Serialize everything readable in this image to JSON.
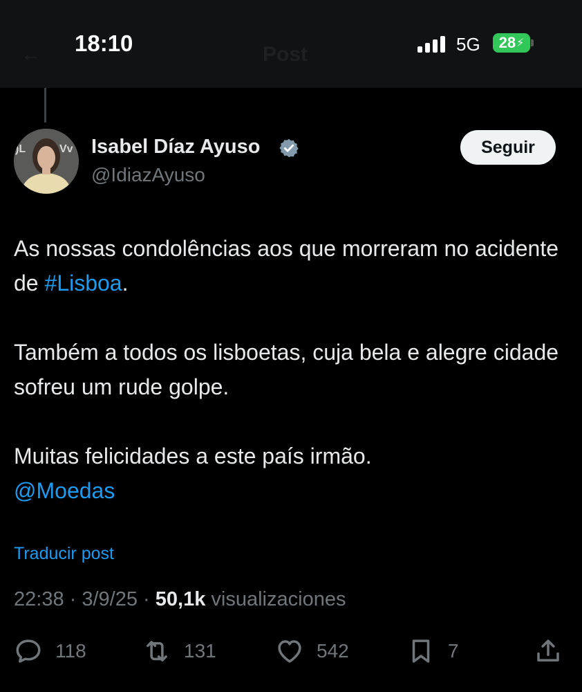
{
  "status_bar": {
    "time": "18:10",
    "network": "5G",
    "battery": "28",
    "background_title": "Post"
  },
  "author": {
    "name": "Isabel Díaz Ayuso",
    "handle": "@IdiazAyuso",
    "verified_icon": "verified-badge-icon",
    "follow_label": "Seguir"
  },
  "tweet": {
    "p1_text": "As nossas condolências aos que morreram no acidente de ",
    "p1_hashtag": "#Lisboa",
    "p1_end": ".",
    "p2_text": "Também a todos os lisboetas, cuja bela e alegre cidade sofreu um rude golpe.",
    "p3_text": "Muitas felicidades a este país irmão.",
    "p3_mention": "@Moedas"
  },
  "translate_label": "Traducir post",
  "meta": {
    "time": "22:38",
    "sep1": " · ",
    "date": "3/9/25",
    "sep2": " · ",
    "views_count": "50,1k",
    "views_label": " visualizaciones"
  },
  "actions": {
    "replies": "118",
    "reposts": "131",
    "likes": "542",
    "bookmarks": "7"
  },
  "colors": {
    "background": "#000000",
    "text": "#e7e9ea",
    "muted": "#71767b",
    "link": "#1d9bf0",
    "battery": "#32c759",
    "verified": "#829aab"
  }
}
